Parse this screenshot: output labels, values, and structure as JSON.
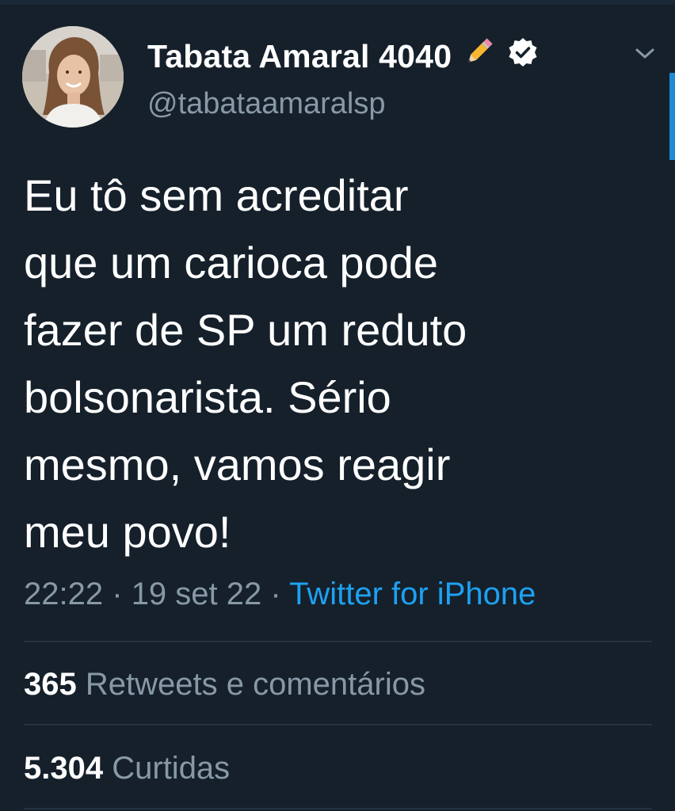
{
  "user": {
    "display_name": "Tabata Amaral 4040",
    "handle": "@tabataamaralsp",
    "name_emoji": "pencil-icon",
    "verified": true
  },
  "tweet": {
    "text_lines": [
      "Eu tô sem acreditar",
      "que um carioca pode",
      "fazer de SP um reduto",
      "bolsonarista. Sério",
      "mesmo, vamos reagir",
      "meu povo!"
    ],
    "time": "22:22",
    "separator": "·",
    "date": "19 set 22",
    "source": "Twitter for iPhone"
  },
  "stats": {
    "retweets_count": "365",
    "retweets_label": "Retweets e comentários",
    "likes_count": "5.304",
    "likes_label": "Curtidas"
  },
  "colors": {
    "background": "#15202b",
    "text_primary": "#ffffff",
    "text_secondary": "#8899a6",
    "link": "#1da1f2",
    "divider": "#253341",
    "scrollbar": "#1d8ad6"
  },
  "icons": {
    "menu": "chevron-down-icon",
    "verified": "verified-badge-icon",
    "avatar": "profile-photo"
  }
}
